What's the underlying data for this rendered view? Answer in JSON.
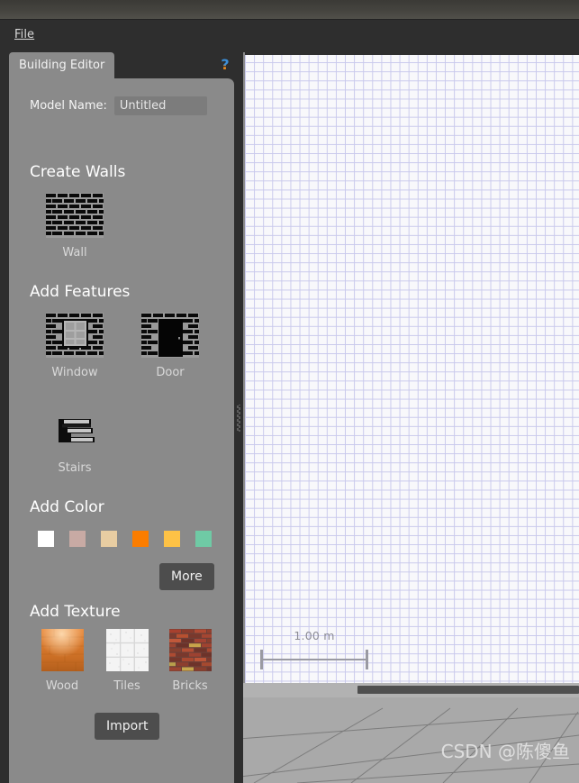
{
  "window": {
    "title": ""
  },
  "menubar": {
    "items": [
      {
        "label": "File",
        "accel": "F"
      }
    ]
  },
  "dock": {
    "tab": {
      "label": "Building Editor"
    },
    "help": {
      "glyph": "?",
      "name": "help-icon"
    },
    "model_name": {
      "label": "Model Name:",
      "value": "Untitled",
      "placeholder": "Untitled"
    },
    "sections": {
      "create_walls": {
        "title": "Create Walls",
        "items": [
          {
            "label": "Wall",
            "icon": "brick-wall-icon"
          }
        ]
      },
      "add_features": {
        "title": "Add Features",
        "items": [
          {
            "label": "Window",
            "icon": "window-icon"
          },
          {
            "label": "Door",
            "icon": "door-icon"
          },
          {
            "label": "Stairs",
            "icon": "stairs-icon"
          }
        ]
      },
      "add_color": {
        "title": "Add Color",
        "swatches": [
          {
            "name": "white",
            "hex": "#ffffff"
          },
          {
            "name": "dusty-rose",
            "hex": "#c8aaa4"
          },
          {
            "name": "tan",
            "hex": "#e8cda2"
          },
          {
            "name": "orange",
            "hex": "#fb7d00"
          },
          {
            "name": "amber",
            "hex": "#fdc246"
          },
          {
            "name": "mint",
            "hex": "#6fcaa5"
          }
        ],
        "more_button": "More"
      },
      "add_texture": {
        "title": "Add Texture",
        "items": [
          {
            "label": "Wood",
            "icon": "wood-texture-icon"
          },
          {
            "label": "Tiles",
            "icon": "tiles-texture-icon"
          },
          {
            "label": "Bricks",
            "icon": "bricks-texture-icon"
          }
        ],
        "import_button": "Import"
      }
    }
  },
  "viewport": {
    "scale_bar": {
      "value": "1.00 m"
    },
    "watermark": "CSDN @陈傻鱼"
  },
  "colors": {
    "panel_bg": "#8a8a8a",
    "chrome_bg": "#2e2e2e",
    "grid_line": "#c9c9ec",
    "ground": "#a9a9a9",
    "button_bg": "#4d4d4d"
  }
}
